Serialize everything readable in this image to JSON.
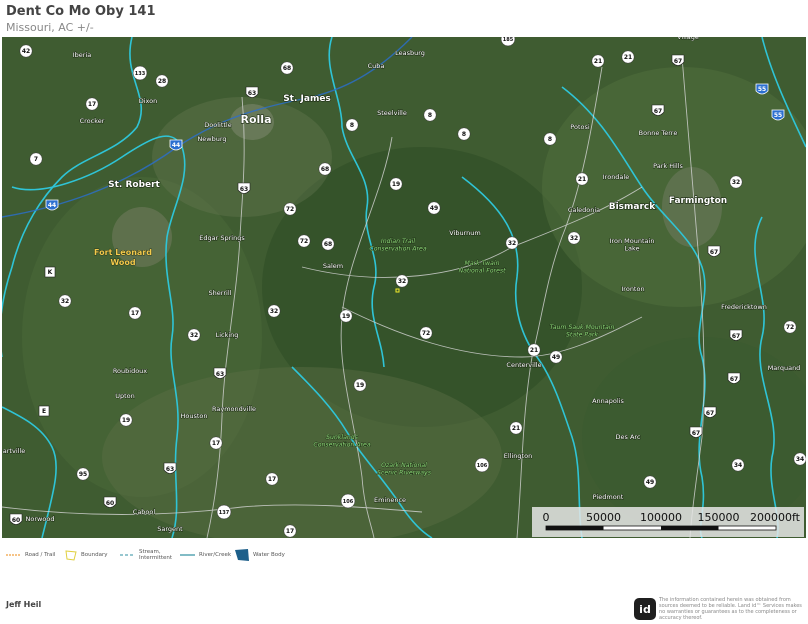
{
  "header": {
    "title": "Dent Co Mo Oby 141",
    "subtitle": "Missouri,  AC +/-"
  },
  "map": {
    "colors": {
      "water": "#2fc4d6",
      "road_major": "#e0e0e0",
      "road_interstate": "#2b6fd0",
      "shield_fill": "#ffffff",
      "label_text": "#ffffff",
      "park_label": "#f2c94c",
      "conservation_label": "#8fdc7a",
      "boundary": "#f5ee2a"
    },
    "cities": [
      {
        "id": "rolla",
        "label": "Rolla"
      },
      {
        "id": "st-james",
        "label": "St. James"
      },
      {
        "id": "st-robert",
        "label": "St. Robert"
      },
      {
        "id": "bismarck",
        "label": "Bismarck"
      },
      {
        "id": "farmington",
        "label": "Farmington"
      }
    ],
    "towns": [
      {
        "id": "iberia",
        "label": "Iberia"
      },
      {
        "id": "cuba",
        "label": "Cuba"
      },
      {
        "id": "leasburg",
        "label": "Leasburg"
      },
      {
        "id": "village",
        "label": "Village"
      },
      {
        "id": "dixon",
        "label": "Dixon"
      },
      {
        "id": "crocker",
        "label": "Crocker"
      },
      {
        "id": "doolittle",
        "label": "Doolittle"
      },
      {
        "id": "newburg",
        "label": "Newburg"
      },
      {
        "id": "steelville",
        "label": "Steelville"
      },
      {
        "id": "potosi",
        "label": "Potosi"
      },
      {
        "id": "bonne-terre",
        "label": "Bonne Terre"
      },
      {
        "id": "park-hills",
        "label": "Park Hills"
      },
      {
        "id": "irondale",
        "label": "Irondale"
      },
      {
        "id": "caledonia",
        "label": "Caledonia"
      },
      {
        "id": "edgar-springs",
        "label": "Edgar Springs"
      },
      {
        "id": "viburnum",
        "label": "Viburnum"
      },
      {
        "id": "iron-mountain-lake",
        "label": "Iron Mountain\nLake"
      },
      {
        "id": "salem",
        "label": "Salem"
      },
      {
        "id": "sherrill",
        "label": "Sherrill"
      },
      {
        "id": "ironton",
        "label": "Ironton"
      },
      {
        "id": "fredericktown",
        "label": "Fredericktown"
      },
      {
        "id": "licking",
        "label": "Licking"
      },
      {
        "id": "roubidoux",
        "label": "Roubidoux"
      },
      {
        "id": "centerville",
        "label": "Centerville"
      },
      {
        "id": "marquand",
        "label": "Marquand"
      },
      {
        "id": "upton",
        "label": "Upton"
      },
      {
        "id": "raymondville",
        "label": "Raymondville"
      },
      {
        "id": "houston",
        "label": "Houston"
      },
      {
        "id": "annapolis",
        "label": "Annapolis"
      },
      {
        "id": "des-arc",
        "label": "Des Arc"
      },
      {
        "id": "ellington",
        "label": "Ellington"
      },
      {
        "id": "artville",
        "label": "artville"
      },
      {
        "id": "piedmont",
        "label": "Piedmont"
      },
      {
        "id": "eminence",
        "label": "Eminence"
      },
      {
        "id": "norwood",
        "label": "Norwood"
      },
      {
        "id": "cabool",
        "label": "Cabool"
      },
      {
        "id": "sargent",
        "label": "Sargent"
      }
    ],
    "areas": [
      {
        "id": "fort-leonard-wood",
        "label": "Fort Leonard\nWood",
        "kind": "park"
      },
      {
        "id": "indian-trail",
        "label": "Indian Trail\nConservation Area",
        "kind": "conservation"
      },
      {
        "id": "mark-twain",
        "label": "Mark Twain\nNational Forest",
        "kind": "conservation"
      },
      {
        "id": "taum-sauk",
        "label": "Taum Sauk Mountain\nState Park",
        "kind": "conservation"
      },
      {
        "id": "sunklands",
        "label": "Sunklands\nConservation Area",
        "kind": "conservation"
      },
      {
        "id": "ozark-riverways",
        "label": "Ozark National\nScenic Riverways",
        "kind": "conservation"
      }
    ],
    "shields": [
      {
        "id": "42",
        "label": "42",
        "type": "state"
      },
      {
        "id": "185",
        "label": "185",
        "type": "state"
      },
      {
        "id": "133",
        "label": "133",
        "type": "state"
      },
      {
        "id": "28",
        "label": "28",
        "type": "state"
      },
      {
        "id": "68a",
        "label": "68",
        "type": "state"
      },
      {
        "id": "21a",
        "label": "21",
        "type": "state"
      },
      {
        "id": "21b",
        "label": "21",
        "type": "state"
      },
      {
        "id": "67a",
        "label": "67",
        "type": "us"
      },
      {
        "id": "55a",
        "label": "55",
        "type": "interstate"
      },
      {
        "id": "55b",
        "label": "55",
        "type": "interstate"
      },
      {
        "id": "17a",
        "label": "17",
        "type": "state"
      },
      {
        "id": "63a",
        "label": "63",
        "type": "us"
      },
      {
        "id": "44a",
        "label": "44",
        "type": "interstate"
      },
      {
        "id": "8a",
        "label": "8",
        "type": "state"
      },
      {
        "id": "8b",
        "label": "8",
        "type": "state"
      },
      {
        "id": "8c",
        "label": "8",
        "type": "state"
      },
      {
        "id": "8d",
        "label": "8",
        "type": "state"
      },
      {
        "id": "67b",
        "label": "67",
        "type": "us"
      },
      {
        "id": "7",
        "label": "7",
        "type": "state"
      },
      {
        "id": "68b",
        "label": "68",
        "type": "state"
      },
      {
        "id": "19a",
        "label": "19",
        "type": "state"
      },
      {
        "id": "21c",
        "label": "21",
        "type": "state"
      },
      {
        "id": "32a",
        "label": "32",
        "type": "state"
      },
      {
        "id": "44b",
        "label": "44",
        "type": "interstate"
      },
      {
        "id": "63b",
        "label": "63",
        "type": "us"
      },
      {
        "id": "72a",
        "label": "72",
        "type": "state"
      },
      {
        "id": "49",
        "label": "49",
        "type": "state"
      },
      {
        "id": "32b",
        "label": "32",
        "type": "state"
      },
      {
        "id": "32c",
        "label": "32",
        "type": "state"
      },
      {
        "id": "72b",
        "label": "72",
        "type": "state"
      },
      {
        "id": "68c",
        "label": "68",
        "type": "state"
      },
      {
        "id": "67c",
        "label": "67",
        "type": "us"
      },
      {
        "id": "k",
        "label": "K",
        "type": "county"
      },
      {
        "id": "32d",
        "label": "32",
        "type": "state"
      },
      {
        "id": "32e",
        "label": "32",
        "type": "state"
      },
      {
        "id": "17b",
        "label": "17",
        "type": "state"
      },
      {
        "id": "32f",
        "label": "32",
        "type": "state"
      },
      {
        "id": "32g",
        "label": "32",
        "type": "state"
      },
      {
        "id": "72c",
        "label": "72",
        "type": "state"
      },
      {
        "id": "19b",
        "label": "19",
        "type": "state"
      },
      {
        "id": "72d",
        "label": "72",
        "type": "state"
      },
      {
        "id": "67d",
        "label": "67",
        "type": "us"
      },
      {
        "id": "21d",
        "label": "21",
        "type": "state"
      },
      {
        "id": "49b",
        "label": "49",
        "type": "state"
      },
      {
        "id": "63c",
        "label": "63",
        "type": "us"
      },
      {
        "id": "19c",
        "label": "19",
        "type": "state"
      },
      {
        "id": "67e",
        "label": "67",
        "type": "us"
      },
      {
        "id": "e",
        "label": "E",
        "type": "county"
      },
      {
        "id": "19d",
        "label": "19",
        "type": "state"
      },
      {
        "id": "17c",
        "label": "17",
        "type": "state"
      },
      {
        "id": "67f",
        "label": "67",
        "type": "us"
      },
      {
        "id": "21e",
        "label": "21",
        "type": "state"
      },
      {
        "id": "67g",
        "label": "67",
        "type": "us"
      },
      {
        "id": "95",
        "label": "95",
        "type": "state"
      },
      {
        "id": "63d",
        "label": "63",
        "type": "us"
      },
      {
        "id": "106a",
        "label": "106",
        "type": "state"
      },
      {
        "id": "34a",
        "label": "34",
        "type": "state"
      },
      {
        "id": "34b",
        "label": "34",
        "type": "state"
      },
      {
        "id": "17d",
        "label": "17",
        "type": "state"
      },
      {
        "id": "49c",
        "label": "49",
        "type": "state"
      },
      {
        "id": "60a",
        "label": "60",
        "type": "us"
      },
      {
        "id": "106b",
        "label": "106",
        "type": "state"
      },
      {
        "id": "60b",
        "label": "60",
        "type": "us"
      },
      {
        "id": "137",
        "label": "137",
        "type": "state"
      },
      {
        "id": "17e",
        "label": "17",
        "type": "state"
      }
    ],
    "scale": {
      "ticks": [
        "0",
        "50000",
        "100000",
        "150000",
        "200000ft"
      ]
    }
  },
  "legend": {
    "items": [
      {
        "id": "road-trail",
        "label": "Road / Trail"
      },
      {
        "id": "boundary",
        "label": "Boundary"
      },
      {
        "id": "stream",
        "label": "Stream,\nIntermittent"
      },
      {
        "id": "river-creek",
        "label": "River/Creek"
      },
      {
        "id": "water-body",
        "label": "Water Body"
      }
    ]
  },
  "footer": {
    "agent_name": "Jeff Heil",
    "logo_text": "id",
    "disclaimer": "The information contained herein was obtained from sources deemed to be reliable. Land id™ Services makes no warranties or guarantees as to the completeness or accuracy thereof."
  }
}
